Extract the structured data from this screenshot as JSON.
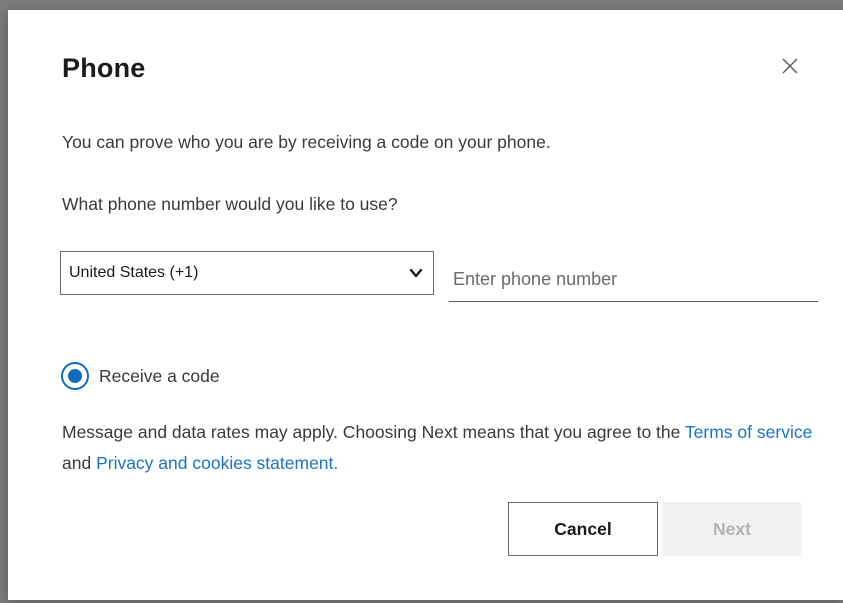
{
  "dialog": {
    "title": "Phone",
    "description": "You can prove who you are by receiving a code on your phone.",
    "question": "What phone number would you like to use?",
    "country_select": {
      "selected": "United States (+1)"
    },
    "phone_input": {
      "value": "",
      "placeholder": "Enter phone number"
    },
    "method": {
      "label": "Receive a code",
      "selected": true
    },
    "notice": {
      "text_before": "Message and data rates may apply. Choosing Next means that you agree to the ",
      "terms_link": "Terms of service",
      "text_middle": " and ",
      "privacy_link": "Privacy and cookies statement.",
      "text_after": ""
    },
    "buttons": {
      "cancel": "Cancel",
      "next": "Next"
    }
  },
  "icons": {
    "close": "close-icon",
    "dropdown": "chevron-down-icon"
  },
  "colors": {
    "accent": "#0f6cbd",
    "link": "#1a73c4",
    "disabled_bg": "#f1f1f1",
    "disabled_text": "#b3b3b3"
  }
}
